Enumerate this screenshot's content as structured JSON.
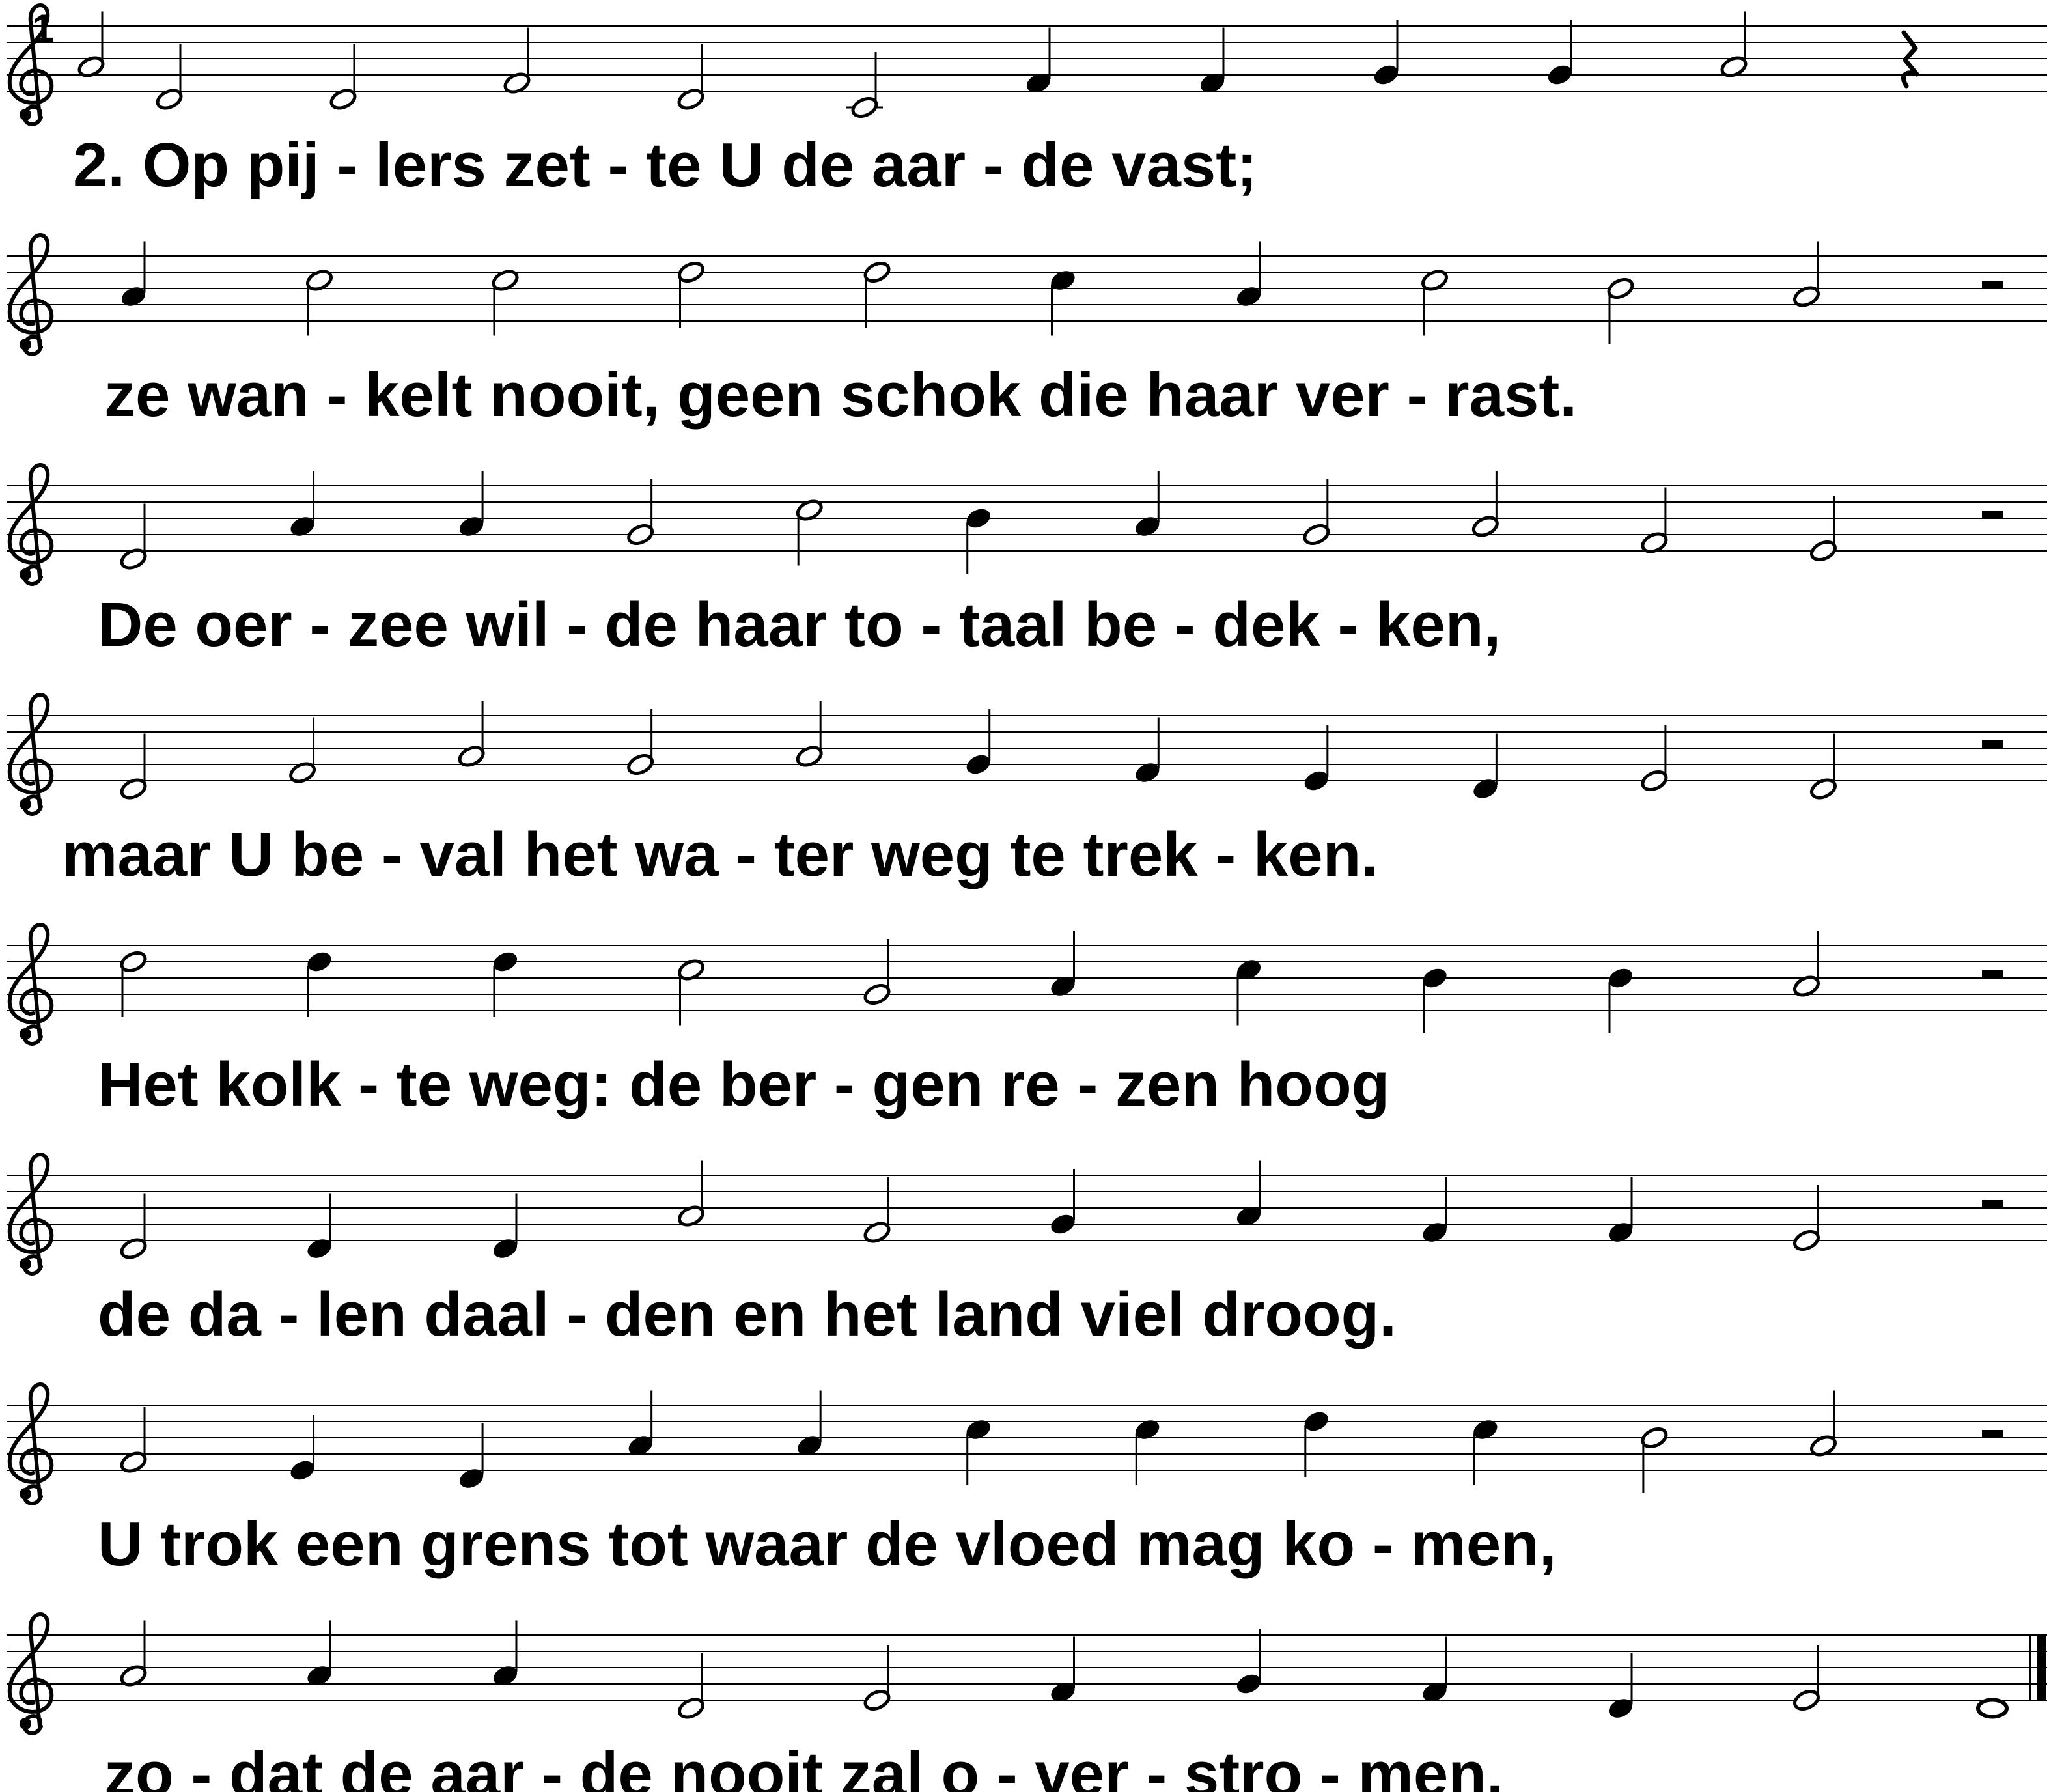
{
  "song": {
    "measure_number": "1",
    "systems": [
      {
        "notes": [
          {
            "p": "A4",
            "d": "h"
          },
          {
            "p": "D4",
            "d": "h"
          },
          {
            "p": "D4",
            "d": "h"
          },
          {
            "p": "F4",
            "d": "h"
          },
          {
            "p": "D4",
            "d": "h"
          },
          {
            "p": "C4",
            "d": "h"
          },
          {
            "p": "F4",
            "d": "q"
          },
          {
            "p": "F4",
            "d": "q"
          },
          {
            "p": "G4",
            "d": "q"
          },
          {
            "p": "G4",
            "d": "q"
          },
          {
            "p": "A4",
            "d": "h"
          },
          {
            "r": "q"
          }
        ],
        "lyrics": [
          "2.",
          "Op",
          "pij",
          "-",
          "lers",
          "zet",
          "-",
          "te",
          "U",
          "de",
          "aar",
          "-",
          "de",
          "vast;"
        ]
      },
      {
        "notes": [
          {
            "p": "A4",
            "d": "q"
          },
          {
            "p": "C5",
            "d": "h"
          },
          {
            "p": "C5",
            "d": "h"
          },
          {
            "p": "D5",
            "d": "h"
          },
          {
            "p": "D5",
            "d": "h"
          },
          {
            "p": "C5",
            "d": "q"
          },
          {
            "p": "A4",
            "d": "q"
          },
          {
            "p": "C5",
            "d": "h"
          },
          {
            "p": "B4",
            "d": "h"
          },
          {
            "p": "A4",
            "d": "h"
          },
          {
            "r": "h"
          }
        ],
        "lyrics": [
          "ze",
          "wan",
          "-",
          "kelt",
          "nooit,",
          "geen",
          "schok",
          "die",
          "haar",
          "ver",
          "-",
          "rast."
        ]
      },
      {
        "notes": [
          {
            "p": "D4",
            "d": "h"
          },
          {
            "p": "A4",
            "d": "q"
          },
          {
            "p": "A4",
            "d": "q"
          },
          {
            "p": "G4",
            "d": "h"
          },
          {
            "p": "C5",
            "d": "h"
          },
          {
            "p": "B4",
            "d": "q"
          },
          {
            "p": "A4",
            "d": "q"
          },
          {
            "p": "G4",
            "d": "h"
          },
          {
            "p": "A4",
            "d": "h"
          },
          {
            "p": "F4",
            "d": "h"
          },
          {
            "p": "E4",
            "d": "h"
          },
          {
            "r": "h"
          }
        ],
        "lyrics": [
          "De",
          "oer",
          "-",
          "zee",
          "wil",
          "-",
          "de",
          "haar",
          "to",
          "-",
          "taal",
          "be",
          "-",
          "dek",
          "-",
          "ken,"
        ]
      },
      {
        "notes": [
          {
            "p": "D4",
            "d": "h"
          },
          {
            "p": "F4",
            "d": "h"
          },
          {
            "p": "A4",
            "d": "h"
          },
          {
            "p": "G4",
            "d": "h"
          },
          {
            "p": "A4",
            "d": "h"
          },
          {
            "p": "G4",
            "d": "q"
          },
          {
            "p": "F4",
            "d": "q"
          },
          {
            "p": "E4",
            "d": "q"
          },
          {
            "p": "D4",
            "d": "q"
          },
          {
            "p": "E4",
            "d": "h"
          },
          {
            "p": "D4",
            "d": "h"
          },
          {
            "r": "h"
          }
        ],
        "lyrics": [
          "maar",
          "U",
          "be",
          "-",
          "val",
          "het",
          "wa",
          "-",
          "ter",
          "weg",
          "te",
          "trek",
          "-",
          "ken."
        ]
      },
      {
        "notes": [
          {
            "p": "D5",
            "d": "h"
          },
          {
            "p": "D5",
            "d": "q"
          },
          {
            "p": "D5",
            "d": "q"
          },
          {
            "p": "C5",
            "d": "h"
          },
          {
            "p": "G4",
            "d": "h"
          },
          {
            "p": "A4",
            "d": "q"
          },
          {
            "p": "C5",
            "d": "q"
          },
          {
            "p": "B4",
            "d": "q"
          },
          {
            "p": "B4",
            "d": "q"
          },
          {
            "p": "A4",
            "d": "h"
          },
          {
            "r": "h"
          }
        ],
        "lyrics": [
          "Het",
          "kolk",
          "-",
          "te",
          "weg:",
          "de",
          "ber",
          "-",
          "gen",
          "re",
          "-",
          "zen",
          "hoog"
        ]
      },
      {
        "notes": [
          {
            "p": "D4",
            "d": "h"
          },
          {
            "p": "D4",
            "d": "q"
          },
          {
            "p": "D4",
            "d": "q"
          },
          {
            "p": "A4",
            "d": "h"
          },
          {
            "p": "F4",
            "d": "h"
          },
          {
            "p": "G4",
            "d": "q"
          },
          {
            "p": "A4",
            "d": "q"
          },
          {
            "p": "F4",
            "d": "q"
          },
          {
            "p": "F4",
            "d": "q"
          },
          {
            "p": "E4",
            "d": "h"
          },
          {
            "r": "h"
          }
        ],
        "lyrics": [
          "de",
          "da",
          "-",
          "len",
          "daal",
          "-",
          "den",
          "en",
          "het",
          "land",
          "viel",
          "droog."
        ]
      },
      {
        "notes": [
          {
            "p": "F4",
            "d": "h"
          },
          {
            "p": "E4",
            "d": "q"
          },
          {
            "p": "D4",
            "d": "q"
          },
          {
            "p": "A4",
            "d": "q"
          },
          {
            "p": "A4",
            "d": "q"
          },
          {
            "p": "C5",
            "d": "q"
          },
          {
            "p": "C5",
            "d": "q"
          },
          {
            "p": "D5",
            "d": "q"
          },
          {
            "p": "C5",
            "d": "q"
          },
          {
            "p": "B4",
            "d": "h"
          },
          {
            "p": "A4",
            "d": "h"
          },
          {
            "r": "h"
          }
        ],
        "lyrics": [
          "U",
          "trok",
          "een",
          "grens",
          "tot",
          "waar",
          "de",
          "vloed",
          "mag",
          "ko",
          "-",
          "men,"
        ]
      },
      {
        "notes": [
          {
            "p": "A4",
            "d": "h"
          },
          {
            "p": "A4",
            "d": "q"
          },
          {
            "p": "A4",
            "d": "q"
          },
          {
            "p": "D4",
            "d": "h"
          },
          {
            "p": "E4",
            "d": "h"
          },
          {
            "p": "F4",
            "d": "q"
          },
          {
            "p": "G4",
            "d": "q"
          },
          {
            "p": "F4",
            "d": "q"
          },
          {
            "p": "D4",
            "d": "q"
          },
          {
            "p": "E4",
            "d": "h"
          },
          {
            "p": "D4",
            "d": "w"
          }
        ],
        "lyrics": [
          "zo",
          "-",
          "dat",
          "de",
          "aar",
          "-",
          "de",
          "nooit",
          "zal",
          "o",
          "-",
          "ver",
          "-",
          "stro",
          "-",
          "men."
        ],
        "final_barline": true
      }
    ]
  }
}
